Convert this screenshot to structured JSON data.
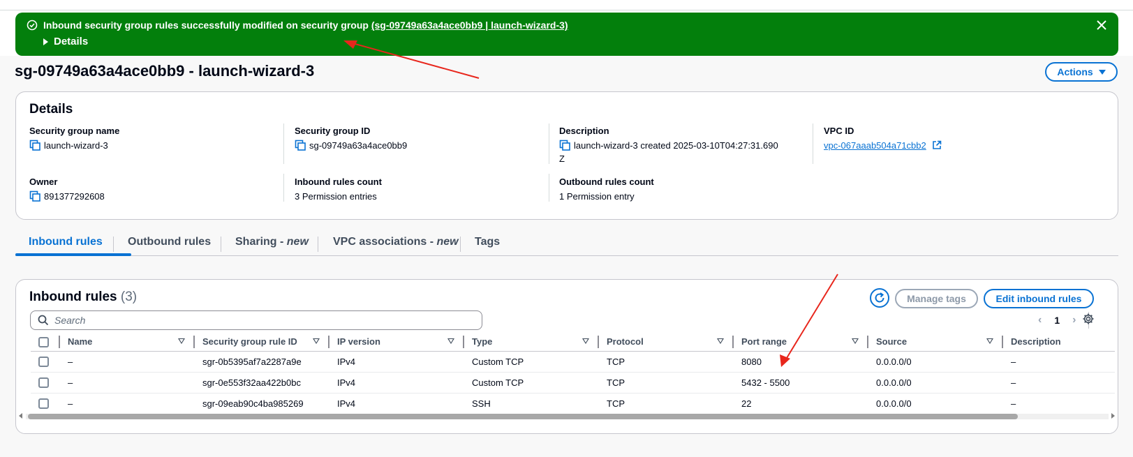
{
  "flash": {
    "message_prefix": "Inbound security group rules successfully modified on security group ",
    "message_link": "(sg-09749a63a4ace0bb9 | launch-wizard-3)",
    "details_label": "Details",
    "check_icon": "success-check-icon",
    "close_icon": "close-icon",
    "color": "#037f0c"
  },
  "page": {
    "title": "sg-09749a63a4ace0bb9 - launch-wizard-3",
    "actions_label": "Actions"
  },
  "details": {
    "title": "Details",
    "fields": {
      "sg_name": {
        "label": "Security group name",
        "value": "launch-wizard-3"
      },
      "sg_id": {
        "label": "Security group ID",
        "value": "sg-09749a63a4ace0bb9"
      },
      "description": {
        "label": "Description",
        "value": "launch-wizard-3 created 2025-03-10T04:27:31.690",
        "value_wrap": "Z"
      },
      "vpc_id": {
        "label": "VPC ID",
        "value": "vpc-067aaab504a71cbb2"
      },
      "owner": {
        "label": "Owner",
        "value": "891377292608"
      },
      "inbound_count": {
        "label": "Inbound rules count",
        "value": "3 Permission entries"
      },
      "outbound_count": {
        "label": "Outbound rules count",
        "value": "1 Permission entry"
      }
    }
  },
  "tabs": [
    {
      "label": "Inbound rules",
      "suffix": "",
      "active": true
    },
    {
      "label": "Outbound rules",
      "suffix": "",
      "active": false
    },
    {
      "label": "Sharing - ",
      "suffix": "new",
      "active": false
    },
    {
      "label": "VPC associations - ",
      "suffix": "new",
      "active": false
    },
    {
      "label": "Tags",
      "suffix": "",
      "active": false
    }
  ],
  "rules": {
    "title": "Inbound rules",
    "count": "(3)",
    "manage_tags_label": "Manage tags",
    "edit_label": "Edit inbound rules",
    "search_placeholder": "Search",
    "page_number": "1",
    "columns": [
      "Name",
      "Security group rule ID",
      "IP version",
      "Type",
      "Protocol",
      "Port range",
      "Source",
      "Description"
    ],
    "rows": [
      {
        "name": "–",
        "rule_id": "sgr-0b5395af7a2287a9e",
        "ip_version": "IPv4",
        "type": "Custom TCP",
        "protocol": "TCP",
        "port_range": "8080",
        "source": "0.0.0.0/0",
        "description": "–"
      },
      {
        "name": "–",
        "rule_id": "sgr-0e553f32aa422b0bc",
        "ip_version": "IPv4",
        "type": "Custom TCP",
        "protocol": "TCP",
        "port_range": "5432 - 5500",
        "source": "0.0.0.0/0",
        "description": "–"
      },
      {
        "name": "–",
        "rule_id": "sgr-09eab90c4ba985269",
        "ip_version": "IPv4",
        "type": "SSH",
        "protocol": "TCP",
        "port_range": "22",
        "source": "0.0.0.0/0",
        "description": "–"
      }
    ]
  },
  "colors": {
    "accent": "#0972d3",
    "annotation": "#e8261c"
  }
}
